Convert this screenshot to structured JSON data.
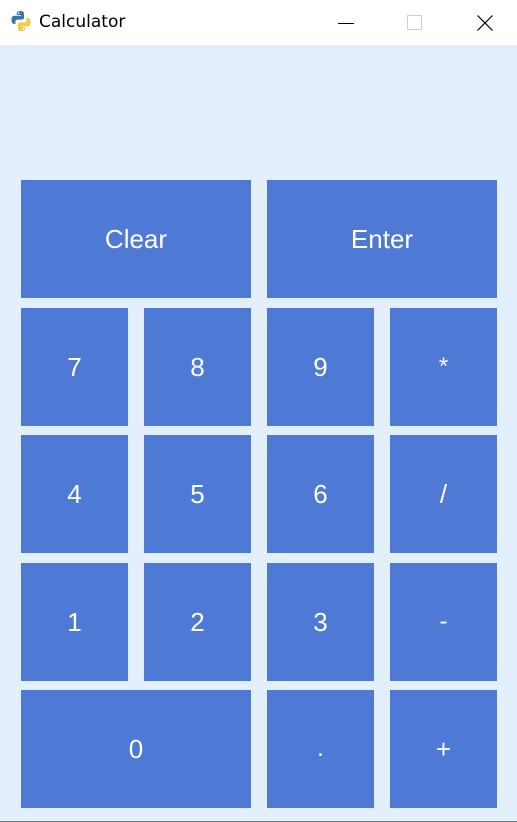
{
  "window": {
    "title": "Calculator",
    "icon": "python-logo-icon",
    "controls": [
      "minimize-icon",
      "maximize-icon",
      "close-icon"
    ]
  },
  "display": {
    "value": ""
  },
  "colors": {
    "background": "#e3f0fb",
    "key": "#4e79d5",
    "key_text": "#ffffff"
  },
  "keys": {
    "clear": "Clear",
    "enter": "Enter",
    "seven": "7",
    "eight": "8",
    "nine": "9",
    "multiply": "*",
    "four": "4",
    "five": "5",
    "six": "6",
    "divide": "/",
    "one": "1",
    "two": "2",
    "three": "3",
    "subtract": "-",
    "zero": "0",
    "decimal": ".",
    "add": "+"
  }
}
